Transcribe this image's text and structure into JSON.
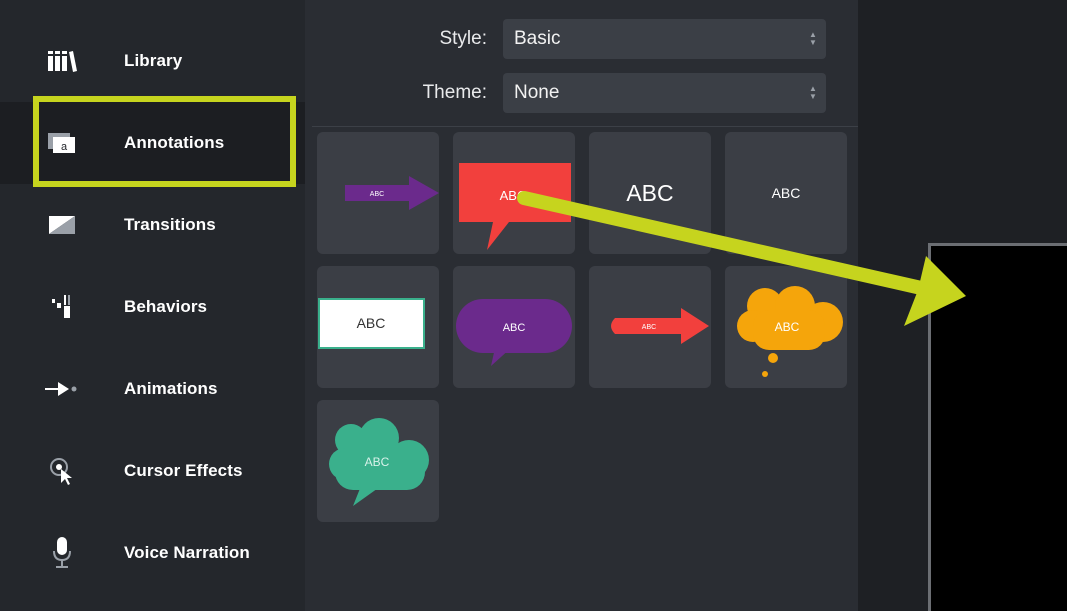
{
  "sidebar": {
    "items": [
      {
        "label": "Library",
        "icon": "library-icon"
      },
      {
        "label": "Annotations",
        "icon": "annotations-icon",
        "selected": true
      },
      {
        "label": "Transitions",
        "icon": "transitions-icon"
      },
      {
        "label": "Behaviors",
        "icon": "behaviors-icon"
      },
      {
        "label": "Animations",
        "icon": "animations-icon"
      },
      {
        "label": "Cursor Effects",
        "icon": "cursor-effects-icon"
      },
      {
        "label": "Voice Narration",
        "icon": "voice-narration-icon"
      }
    ]
  },
  "panel": {
    "style": {
      "label": "Style:",
      "value": "Basic"
    },
    "theme": {
      "label": "Theme:",
      "value": "None"
    }
  },
  "annotations": {
    "tiles": [
      {
        "name": "purple-arrow-callout",
        "text": "ABC",
        "color": "#6b2a8c"
      },
      {
        "name": "red-speech-bubble",
        "text": "ABC",
        "color": "#f2403d"
      },
      {
        "name": "large-text-callout",
        "text": "ABC",
        "color": "#ffffff"
      },
      {
        "name": "small-text-callout",
        "text": "ABC",
        "color": "#ffffff"
      },
      {
        "name": "white-box-callout",
        "text": "ABC",
        "color": "#ffffff"
      },
      {
        "name": "purple-speech-bubble",
        "text": "ABC",
        "color": "#6b2a8c"
      },
      {
        "name": "red-arrow-callout",
        "text": "ABC",
        "color": "#f2403d"
      },
      {
        "name": "orange-thought-cloud",
        "text": "ABC",
        "color": "#f5a50b"
      },
      {
        "name": "green-speech-cloud",
        "text": "ABC",
        "color": "#3ab08c"
      }
    ]
  },
  "overlay": {
    "highlight_color": "#c6d41e",
    "arrow_color": "#c6d41e"
  }
}
